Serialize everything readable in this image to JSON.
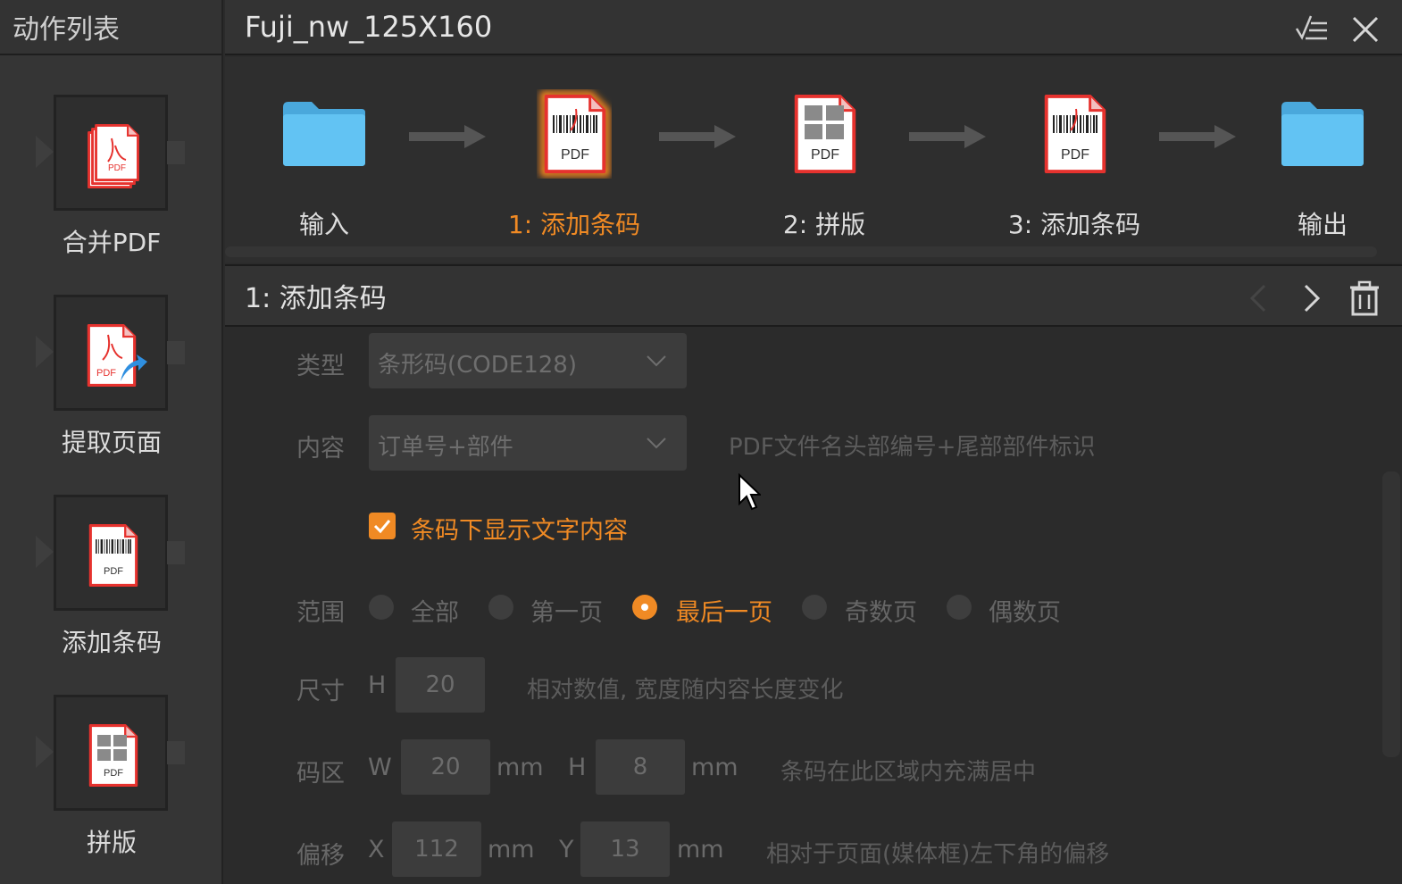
{
  "sidebar": {
    "title": "动作列表",
    "items": [
      {
        "label": "合并PDF",
        "icon": "merge-pdf-icon",
        "badge": "PDF"
      },
      {
        "label": "提取页面",
        "icon": "extract-pages-icon",
        "badge": "PDF"
      },
      {
        "label": "添加条码",
        "icon": "add-barcode-icon",
        "badge": "PDF"
      },
      {
        "label": "拼版",
        "icon": "imposition-icon",
        "badge": "PDF"
      }
    ]
  },
  "window": {
    "title": "Fuji_nw_125X160"
  },
  "pipeline": {
    "steps": [
      {
        "label": "输入",
        "icon": "folder-icon"
      },
      {
        "label": "1: 添加条码",
        "icon": "add-barcode-icon",
        "badge": "PDF",
        "active": true
      },
      {
        "label": "2: 拼版",
        "icon": "imposition-icon",
        "badge": "PDF"
      },
      {
        "label": "3: 添加条码",
        "icon": "add-barcode-icon",
        "badge": "PDF"
      },
      {
        "label": "输出",
        "icon": "folder-icon"
      }
    ]
  },
  "detail": {
    "title": "1: 添加条码",
    "type_label": "类型",
    "type_value": "条形码(CODE128)",
    "content_label": "内容",
    "content_value": "订单号+部件",
    "content_hint": "PDF文件名头部编号+尾部部件标识",
    "show_text_checkbox": {
      "label": "条码下显示文字内容",
      "checked": true
    },
    "range_label": "范围",
    "range_options": [
      "全部",
      "第一页",
      "最后一页",
      "奇数页",
      "偶数页"
    ],
    "range_selected": "最后一页",
    "size_label": "尺寸",
    "size_h_label": "H",
    "size_h_value": "20",
    "size_hint": "相对数值, 宽度随内容长度变化",
    "area_label": "码区",
    "area_w_label": "W",
    "area_w_value": "20",
    "area_h_label": "H",
    "area_h_value": "8",
    "area_unit": "mm",
    "area_hint": "条码在此区域内充满居中",
    "offset_label": "偏移",
    "offset_x_label": "X",
    "offset_x_value": "112",
    "offset_y_label": "Y",
    "offset_y_value": "13",
    "offset_unit": "mm",
    "offset_hint": "相对于页面(媒体框)左下角的偏移"
  },
  "colors": {
    "accent": "#f08a24",
    "folder": "#5bbcf0",
    "pdf_red": "#e6322e",
    "background": "#2b2b2b"
  }
}
